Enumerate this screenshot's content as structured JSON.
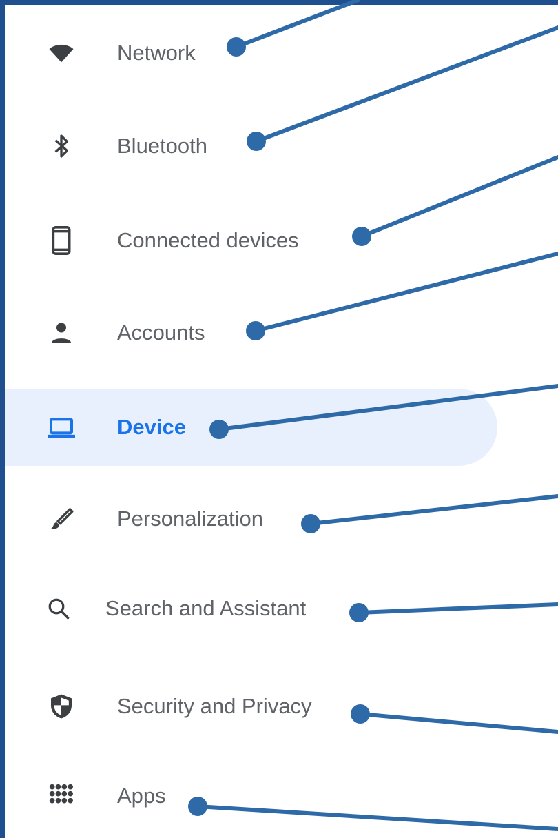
{
  "settings_menu": {
    "items": [
      {
        "label": "Network",
        "icon": "wifi-icon",
        "active": false
      },
      {
        "label": "Bluetooth",
        "icon": "bluetooth-icon",
        "active": false
      },
      {
        "label": "Connected devices",
        "icon": "phone-icon",
        "active": false
      },
      {
        "label": "Accounts",
        "icon": "person-icon",
        "active": false
      },
      {
        "label": "Device",
        "icon": "laptop-icon",
        "active": true
      },
      {
        "label": "Personalization",
        "icon": "brush-icon",
        "active": false
      },
      {
        "label": "Search and Assistant",
        "icon": "search-icon",
        "active": false
      },
      {
        "label": "Security and Privacy",
        "icon": "shield-icon",
        "active": false
      },
      {
        "label": "Apps",
        "icon": "apps-grid-icon",
        "active": false
      }
    ]
  },
  "colors": {
    "frame": "#1f4f8f",
    "callout": "#2f6aa8",
    "text": "#5f6368",
    "active_text": "#1a73e8",
    "active_bg": "#e8f0fe"
  }
}
